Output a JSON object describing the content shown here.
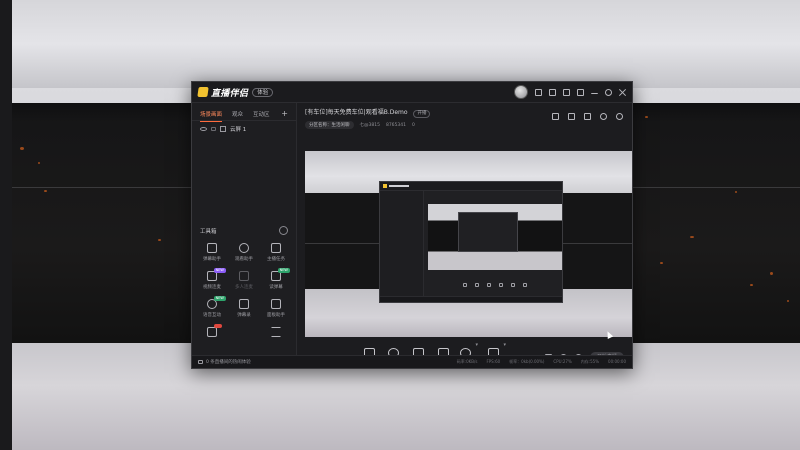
{
  "app": {
    "logo_text": "直播伴侣",
    "version_label": "体验"
  },
  "sidebar": {
    "tabs": [
      {
        "label": "场景画面",
        "active": true
      },
      {
        "label": "观众",
        "active": false
      },
      {
        "label": "互动区",
        "active": false
      }
    ],
    "add_label": "+",
    "scene_label": "云屏 1",
    "tools_title": "工具箱",
    "tools": [
      {
        "label": "弹幕助手",
        "icon": "danmaku-icon",
        "badge": "",
        "dim": false
      },
      {
        "label": "观看助手",
        "icon": "viewer-icon",
        "badge": "",
        "dim": false
      },
      {
        "label": "主播任务",
        "icon": "task-icon",
        "badge": "",
        "dim": false
      },
      {
        "label": "视频连麦",
        "icon": "video-link-icon",
        "badge": "NEW",
        "badge_color": "#8b5cf6",
        "dim": false
      },
      {
        "label": "多人连麦",
        "icon": "download-icon",
        "badge": "",
        "dim": true
      },
      {
        "label": "读弹幕",
        "icon": "read-danmaku-icon",
        "badge": "NEW",
        "badge_color": "#2da36b",
        "dim": false
      },
      {
        "label": "语音互动",
        "icon": "voice-icon",
        "badge": "NEW",
        "badge_color": "#2da36b",
        "dim": false
      },
      {
        "label": "弹幕录",
        "icon": "record-icon",
        "badge": "",
        "dim": false
      },
      {
        "label": "面板助手",
        "icon": "panel-icon",
        "badge": "",
        "dim": false
      },
      {
        "label": "",
        "icon": "pk-icon",
        "badge": "",
        "dim": false
      },
      {
        "label": "",
        "icon": "blank",
        "badge": "",
        "dim": false
      },
      {
        "label": "",
        "icon": "triangle-icon",
        "badge": "",
        "dim": false
      }
    ]
  },
  "main": {
    "room_title": "[有车位]每天免费车位|观看福B.Demo",
    "open_label": "开播",
    "category_label": "分区名称：生活闲聊",
    "meta": [
      "七@3815",
      "8765341",
      "0"
    ]
  },
  "controls": [
    {
      "label": "直播屏幕",
      "icon": "screen-share-icon",
      "caret": false
    },
    {
      "label": "摄像头",
      "icon": "camera-icon",
      "caret": false
    },
    {
      "label": "手机投屏",
      "icon": "phone-cast-icon",
      "caret": false
    },
    {
      "label": "多媒体",
      "icon": "media-icon",
      "caret": false
    },
    {
      "label": "麦克风",
      "icon": "microphone-icon",
      "caret": true
    },
    {
      "label": "扬声器",
      "icon": "speaker-icon",
      "caret": true
    }
  ],
  "start_label": "开始直播",
  "status": {
    "left": "0 条直播间的热闹体验",
    "right": [
      "码率:0KB/s",
      "FPS:60",
      "帧率：0kb(0.00%)",
      "CPU:27%",
      "内存:55%",
      "00:00:00"
    ]
  }
}
